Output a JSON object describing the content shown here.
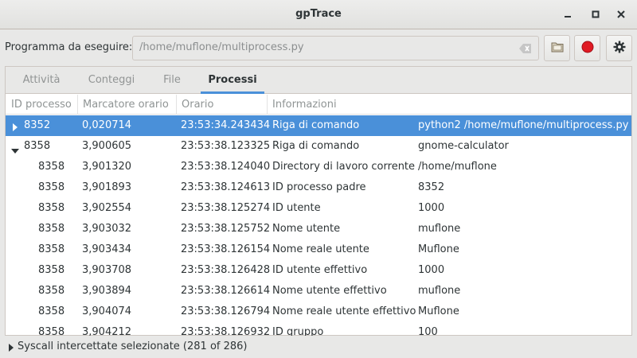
{
  "window": {
    "title": "gpTrace",
    "controls": [
      "minimize-icon",
      "maximize-icon",
      "close-icon"
    ]
  },
  "toolbar": {
    "program_label": "Programma da eseguire:",
    "program_path": "/home/muflone/multiprocess.py",
    "buttons": [
      "clear-icon",
      "folder-icon",
      "record-icon",
      "gear-icon"
    ],
    "record_color": "#e01b24"
  },
  "tabs": [
    {
      "label": "Attività",
      "active": false
    },
    {
      "label": "Conteggi",
      "active": false
    },
    {
      "label": "File",
      "active": false
    },
    {
      "label": "Processi",
      "active": true
    }
  ],
  "table": {
    "columns": [
      "ID processo",
      "Marcatore orario",
      "Orario",
      "Informazioni"
    ],
    "rows": [
      {
        "pid": "8352",
        "marker": "0,020714",
        "time": "23:53:34.243434",
        "info": "Riga di comando",
        "value": "python2 /home/muflone/multiprocess.py",
        "expander": "collapsed",
        "selected": true
      },
      {
        "pid": "8358",
        "marker": "3,900605",
        "time": "23:53:38.123325",
        "info": "Riga di comando",
        "value": "gnome-calculator",
        "expander": "expanded",
        "selected": false
      },
      {
        "pid": "8358",
        "marker": "3,901320",
        "time": "23:53:38.124040",
        "info": "Directory di lavoro corrente",
        "value": "/home/muflone",
        "expander": "none",
        "selected": false
      },
      {
        "pid": "8358",
        "marker": "3,901893",
        "time": "23:53:38.124613",
        "info": "ID processo padre",
        "value": "8352",
        "expander": "none",
        "selected": false
      },
      {
        "pid": "8358",
        "marker": "3,902554",
        "time": "23:53:38.125274",
        "info": "ID utente",
        "value": "1000",
        "expander": "none",
        "selected": false
      },
      {
        "pid": "8358",
        "marker": "3,903032",
        "time": "23:53:38.125752",
        "info": "Nome utente",
        "value": "muflone",
        "expander": "none",
        "selected": false
      },
      {
        "pid": "8358",
        "marker": "3,903434",
        "time": "23:53:38.126154",
        "info": "Nome reale utente",
        "value": "Muflone",
        "expander": "none",
        "selected": false
      },
      {
        "pid": "8358",
        "marker": "3,903708",
        "time": "23:53:38.126428",
        "info": "ID utente effettivo",
        "value": "1000",
        "expander": "none",
        "selected": false
      },
      {
        "pid": "8358",
        "marker": "3,903894",
        "time": "23:53:38.126614",
        "info": "Nome utente effettivo",
        "value": "muflone",
        "expander": "none",
        "selected": false
      },
      {
        "pid": "8358",
        "marker": "3,904074",
        "time": "23:53:38.126794",
        "info": "Nome reale utente effettivo",
        "value": "Muflone",
        "expander": "none",
        "selected": false
      },
      {
        "pid": "8358",
        "marker": "3,904212",
        "time": "23:53:38.126932",
        "info": "ID gruppo",
        "value": "100",
        "expander": "none",
        "selected": false
      }
    ]
  },
  "status": {
    "text": "Syscall intercettate selezionate (281 of 286)"
  }
}
